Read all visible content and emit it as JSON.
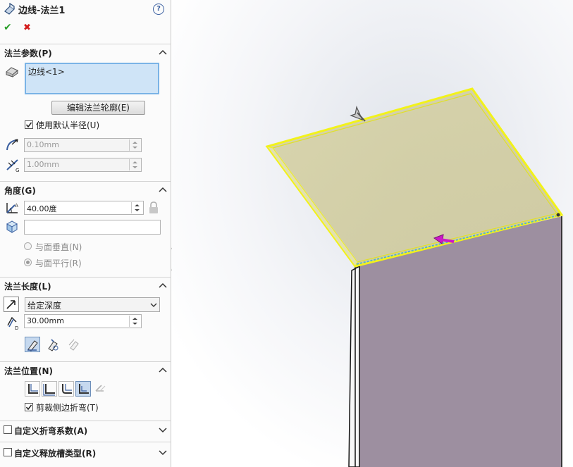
{
  "window": {
    "title": "边线-法兰1",
    "help": "?"
  },
  "actions": {
    "ok": "✔",
    "cancel": "✖"
  },
  "flange_params": {
    "header": "法兰参数(P)",
    "edge_list": [
      "边线<1>"
    ],
    "edit_profile_button": "编辑法兰轮廓(E)",
    "use_default_radius": {
      "label": "使用默认半径(U)",
      "checked": true
    },
    "radius": "0.10mm",
    "gap": "1.00mm"
  },
  "angle": {
    "header": "角度(G)",
    "value": "40.00度",
    "reference_face": "",
    "perpendicular_label": "与面垂直(N)",
    "parallel_label": "与面平行(R)"
  },
  "flange_length": {
    "header": "法兰长度(L)",
    "end_condition": "给定深度",
    "value": "30.00mm"
  },
  "flange_position": {
    "header": "法兰位置(N)",
    "trim_side_bends": {
      "label": "剪裁侧边折弯(T)",
      "checked": true
    }
  },
  "custom_bend_allowance": {
    "label": "自定义折弯系数(A)",
    "checked": false
  },
  "custom_relief_type": {
    "label": "自定义释放槽类型(R)",
    "checked": false
  },
  "colors": {
    "selection_blue": "#cfe4f7",
    "highlight_yellow": "#f2f21a",
    "preview_magenta": "#cc18c8",
    "part_face": "#9d8fa0"
  }
}
